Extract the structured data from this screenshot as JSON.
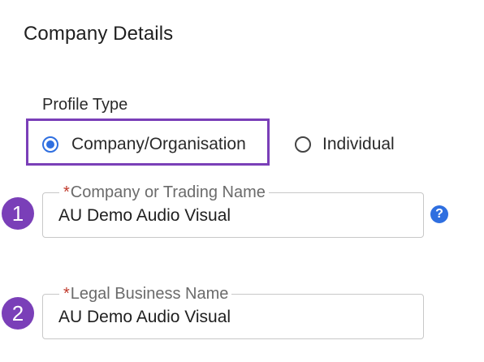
{
  "section": {
    "title": "Company Details"
  },
  "profile_type": {
    "label": "Profile Type",
    "options": [
      {
        "label": "Company/Organisation",
        "selected": true
      },
      {
        "label": "Individual",
        "selected": false
      }
    ]
  },
  "fields": [
    {
      "step": "1",
      "required_mark": "*",
      "label": "Company or Trading Name",
      "value": "AU Demo Audio Visual",
      "help_icon": "question-circle-icon"
    },
    {
      "step": "2",
      "required_mark": "*",
      "label": "Legal Business Name",
      "value": "AU Demo Audio Visual"
    }
  ],
  "colors": {
    "accent": "#2f6fe0",
    "highlight": "#7a3fb8",
    "required": "#c0392b"
  }
}
